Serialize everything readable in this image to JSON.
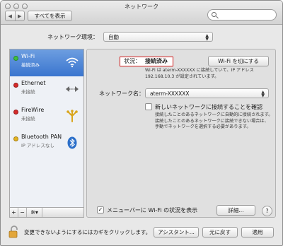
{
  "window": {
    "title": "ネットワーク"
  },
  "toolbar": {
    "back_icon": "◀",
    "forward_icon": "▶",
    "show_all_label": "すべてを表示",
    "search_placeholder": ""
  },
  "location": {
    "label": "ネットワーク環境：",
    "value": "自動"
  },
  "services": [
    {
      "name": "Wi-Fi",
      "status": "接続済み",
      "dot_color": "#3fbf3f",
      "icon": "wifi-icon",
      "selected": true
    },
    {
      "name": "Ethernet",
      "status": "未接続",
      "dot_color": "#d42a2a",
      "icon": "ethernet-icon",
      "selected": false
    },
    {
      "name": "FireWire",
      "status": "未接続",
      "dot_color": "#d42a2a",
      "icon": "firewire-icon",
      "selected": false
    },
    {
      "name": "Bluetooth PAN",
      "status": "IP アドレスなし",
      "dot_color": "#e3b321",
      "icon": "bluetooth-icon",
      "selected": false
    }
  ],
  "sidebar_controls": {
    "add": "+",
    "remove": "−",
    "gear": "✲▾"
  },
  "status": {
    "label": "状況：",
    "value": "接続済み",
    "toggle_label": "Wi-Fi を切にする",
    "description_line1": "Wi-Fi は aterm-XXXXXX に接続していて、IP アドレス",
    "description_line2": "192.168.10.3 が設定されています。"
  },
  "network_name": {
    "label": "ネットワーク名：",
    "value": "aterm-XXXXXX"
  },
  "ask_to_join": {
    "label": "新しいネットワークに接続することを確認",
    "checked": false,
    "desc_line1": "接続したことのあるネットワークに自動的に接続されます。",
    "desc_line2": "接続したことのあるネットワークに接続できない場合は、",
    "desc_line3": "手動でネットワークを選択する必要があります。"
  },
  "menubar": {
    "label": "メニューバーに Wi-Fi の状況を表示",
    "checked": true
  },
  "advanced_label": "詳細...",
  "help_label": "?",
  "footer": {
    "lock_text": "変更できないようにするにはカギをクリックします。",
    "assistant_label": "アシスタント...",
    "revert_label": "元に戻す",
    "apply_label": "適用"
  },
  "colors": {
    "selection": "#3a75cf",
    "status_box": "#d21b1b"
  }
}
